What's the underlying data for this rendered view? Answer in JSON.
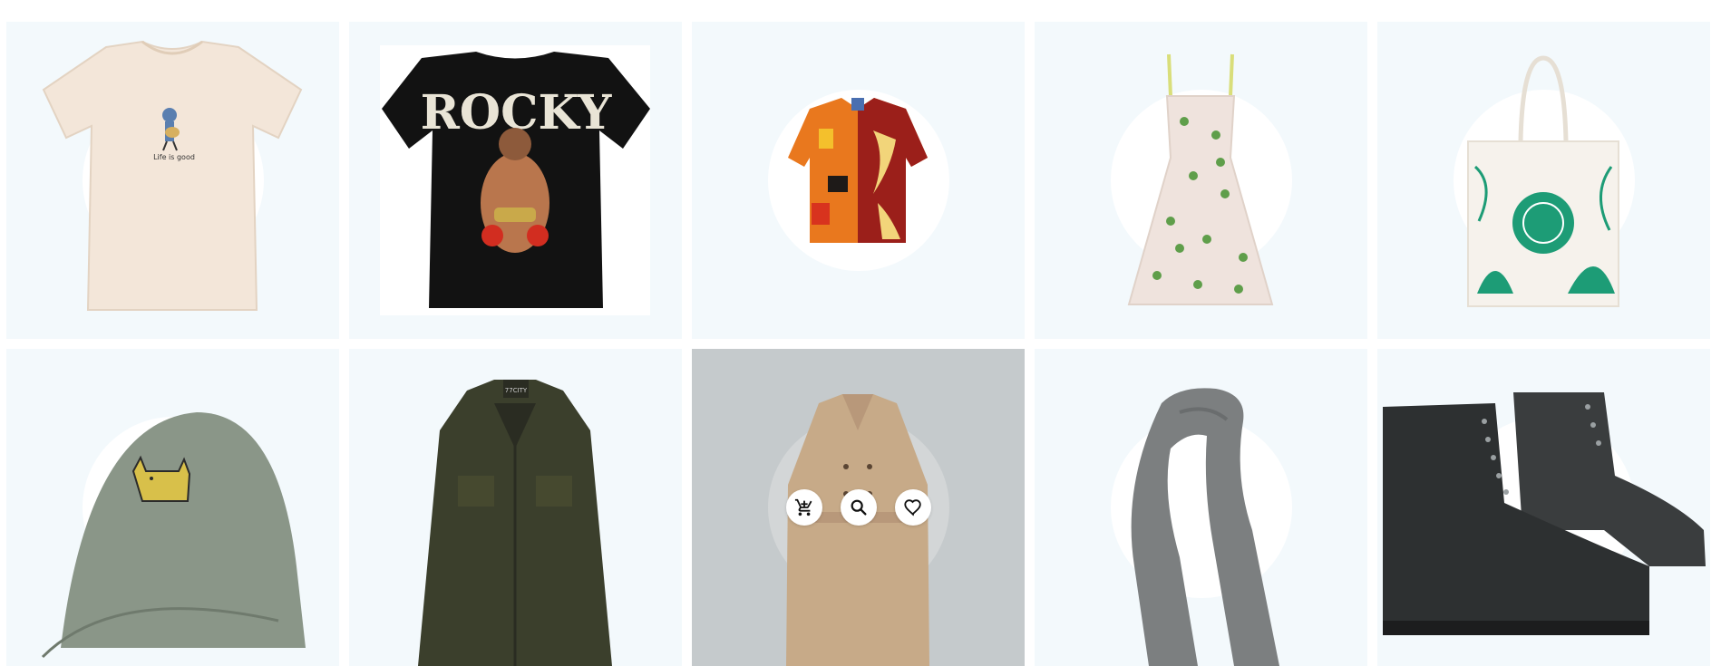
{
  "products": [
    {
      "name": "life-is-good-tee",
      "print": "Life is good"
    },
    {
      "name": "rocky-tee",
      "print": "ROCKY"
    },
    {
      "name": "pattern-shirt"
    },
    {
      "name": "floral-dress"
    },
    {
      "name": "tote-bag"
    },
    {
      "name": "cat-cap"
    },
    {
      "name": "green-jacket",
      "label": "77CITY"
    },
    {
      "name": "trench-coat"
    },
    {
      "name": "grey-scarf"
    },
    {
      "name": "black-boots"
    }
  ],
  "actions": {
    "cart_icon": "add-to-cart-icon",
    "search_icon": "search-icon",
    "wishlist_icon": "heart-icon"
  },
  "colors": {
    "card_bg": "#f3f9fc",
    "card_hover_bg": "#c5cacc",
    "circle": "#ffffff"
  }
}
